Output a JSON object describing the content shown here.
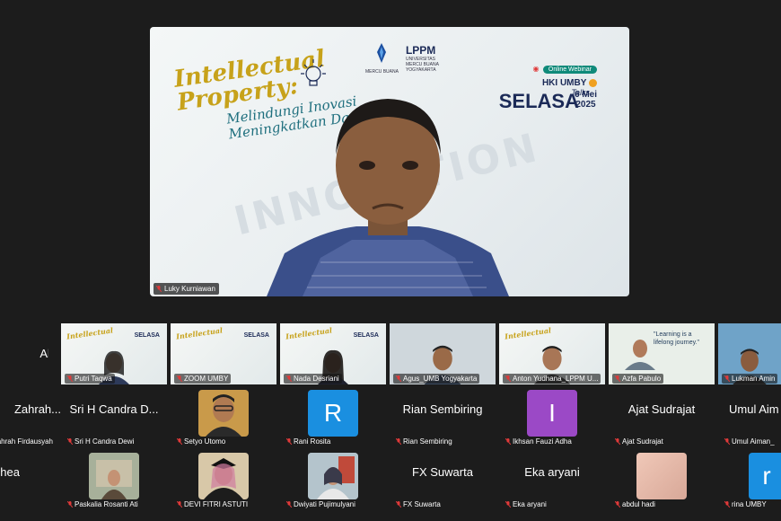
{
  "speaker": {
    "name": "Luky Kurniawan",
    "banner": {
      "title_line1": "Intellectual",
      "title_line2": "Property:",
      "subtitle_line1": "Melindungi Inovasi",
      "subtitle_line2": "Meningkatkan Daya",
      "background_word": "INNOVATION",
      "org_left": "MERCU BUANA",
      "org_lppm": "LPPM",
      "org_lppm_sub": "UNIVERSITAS MERCU BUANA YOGYAKARTA",
      "badge": "Online Webinar",
      "event": "HKI UMBY",
      "event_sub": "Talks",
      "day": "SELASA",
      "date_line1": "6 Mei",
      "date_line2": "2025"
    }
  },
  "row1": [
    {
      "label": "Alin",
      "type": "name-only"
    },
    {
      "label": "Putri Taqwa",
      "type": "banner-face"
    },
    {
      "label": "ZOOM UMBY",
      "type": "banner"
    },
    {
      "label": "Nada Desriani",
      "type": "banner-face"
    },
    {
      "label": "Agus_UMB Yogyakarta",
      "type": "photo"
    },
    {
      "label": "Anton Yudhana_LPPM U...",
      "type": "banner-face"
    },
    {
      "label": "Azfa Pabulo",
      "type": "quote",
      "quote": "\"Learning is a lifelong journey.\""
    },
    {
      "label": "Lukman Amin",
      "type": "photo"
    }
  ],
  "row2": [
    {
      "title": "Zahrah...",
      "label": "ahrah Firdausyah",
      "type": "name-only"
    },
    {
      "title": "Sri H Candra D...",
      "label": "Sri H Candra Dewi",
      "type": "name-only"
    },
    {
      "title": "",
      "label": "Setyo Utomo",
      "type": "avatar"
    },
    {
      "title": "R",
      "label": "Rani Rosita",
      "type": "letter",
      "color": "#1a8fe0"
    },
    {
      "title": "Rian Sembiring",
      "label": "Rian Sembiring",
      "type": "name-only"
    },
    {
      "title": "I",
      "label": "Ikhsan Fauzi Adha",
      "type": "letter",
      "color": "#9b49c6"
    },
    {
      "title": "Ajat Sudrajat",
      "label": "Ajat Sudrajat",
      "type": "name-only"
    },
    {
      "title": "Umul Aim",
      "label": "Umul Aiman_",
      "type": "name-only"
    }
  ],
  "row3": [
    {
      "title": "hea",
      "label": "",
      "type": "name-only"
    },
    {
      "title": "",
      "label": "Paskalia Rosanti Ati",
      "type": "avatar"
    },
    {
      "title": "",
      "label": "DEVI FITRI ASTUTI",
      "type": "avatar"
    },
    {
      "title": "",
      "label": "Dwiyati Pujimulyani",
      "type": "avatar"
    },
    {
      "title": "FX Suwarta",
      "label": "FX Suwarta",
      "type": "name-only"
    },
    {
      "title": "Eka aryani",
      "label": "Eka aryani",
      "type": "name-only"
    },
    {
      "title": "",
      "label": "abdul hadi",
      "type": "avatar"
    },
    {
      "title": "r",
      "label": "rina UMBY",
      "type": "letter",
      "color": "#1a8fe0"
    }
  ],
  "colors": {
    "background": "#1c1c1c",
    "muted_mic": "#e03a3a",
    "accent_gold": "#c7a21a",
    "accent_navy": "#1b2a57"
  }
}
